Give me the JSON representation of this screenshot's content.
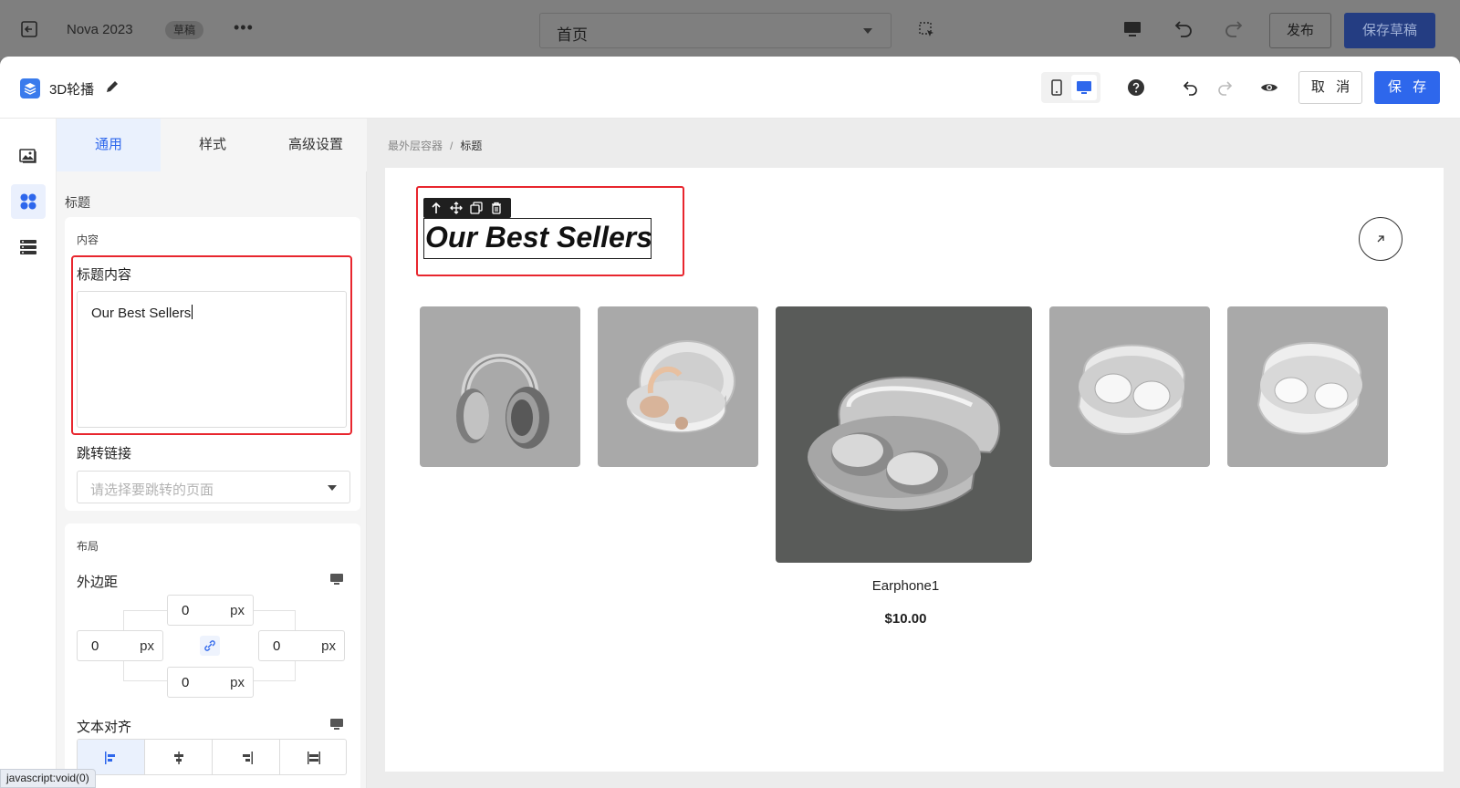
{
  "topbar": {
    "project_name": "Nova 2023",
    "status_badge": "草稿",
    "more": "•••",
    "page_select": "首页",
    "publish_label": "发布",
    "save_draft_label": "保存草稿"
  },
  "modal": {
    "title": "3D轮播",
    "cancel_label": "取 消",
    "save_label": "保 存"
  },
  "panel": {
    "tabs": [
      {
        "label": "通用",
        "active": true
      },
      {
        "label": "样式",
        "active": false
      },
      {
        "label": "高级设置",
        "active": false
      }
    ],
    "section_title": "标题",
    "content_card": {
      "title": "内容",
      "title_field_label": "标题内容",
      "title_field_value": "Our Best Sellers",
      "link_label": "跳转链接",
      "link_placeholder": "请选择要跳转的页面"
    },
    "layout_card": {
      "title": "布局",
      "margin_label": "外边距",
      "margin": {
        "top": "0",
        "left": "0",
        "right": "0",
        "bottom": "0",
        "unit": "px"
      },
      "text_align_label": "文本对齐",
      "text_align_active": "left"
    }
  },
  "statusbar": "javascript:void(0)",
  "canvas": {
    "breadcrumb": {
      "parent": "最外层容器",
      "separator": "/",
      "current": "标题"
    },
    "heading": "Our Best Sellers",
    "product": {
      "name": "Earphone1",
      "price": "$10.00"
    }
  },
  "colors": {
    "accent": "#2e67ec",
    "highlight": "#e8262e",
    "tab_active_bg": "#eaf1fd"
  }
}
